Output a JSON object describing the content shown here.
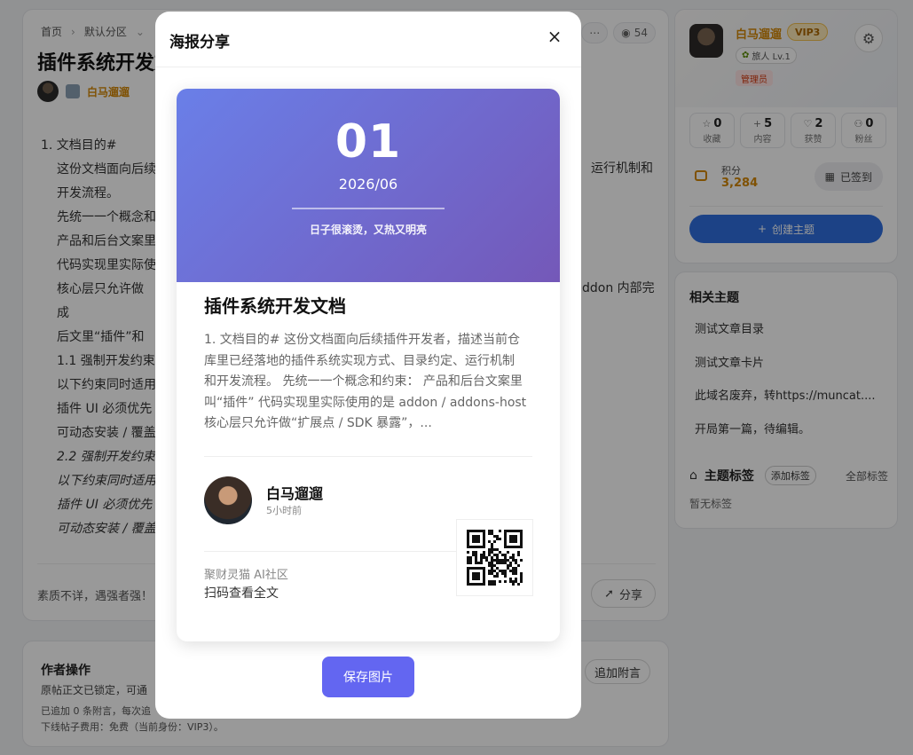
{
  "page": {
    "breadcrumb": [
      "首页",
      "默认分区"
    ],
    "title": "插件系统开发文",
    "views": "54",
    "author_name": "白马遛遛",
    "article_lines": [
      {
        "text": "1. 文档目的#",
        "style": "head"
      },
      {
        "text": "这份文档面向后续",
        "style": "ind"
      },
      {
        "text": "开发流程。",
        "style": "ind"
      },
      {
        "text": "先统一一个概念和",
        "style": "ind"
      },
      {
        "text": "产品和后台文案里",
        "style": "ind"
      },
      {
        "text": "代码实现里实际使",
        "style": "ind"
      },
      {
        "text": "核心层只允许做",
        "style": "ind"
      },
      {
        "text": "成",
        "style": "ind"
      },
      {
        "text": "后文里“插件”和",
        "style": "ind"
      },
      {
        "text": "1.1 强制开发约束",
        "style": "ind"
      },
      {
        "text": "以下约束同时适用",
        "style": "ind"
      },
      {
        "text": "插件 UI 必须优先",
        "style": "ind"
      },
      {
        "text": "可动态安装 / 覆盖",
        "style": "ind"
      },
      {
        "text": "2.2 强制开发约束",
        "style": "ind em"
      },
      {
        "text": "以下约束同时适用",
        "style": "ind em"
      },
      {
        "text": "插件 UI 必须优先",
        "style": "ind em"
      },
      {
        "text": "可动态安装 / 覆盖",
        "style": "ind em"
      }
    ],
    "right_fragment_1": "运行机制和",
    "right_fragment_2": "ddon 内部完",
    "motto": "素质不详，遇强者强！",
    "share_label": "分享"
  },
  "author_ops": {
    "title": "作者操作",
    "line1": "原帖正文已锁定，可通",
    "line2": "已追加 0 条附言，每次追",
    "line3": "下线帖子费用：免费（当前身份：VIP3）。",
    "append_label": "追加附言"
  },
  "profile": {
    "name": "白马遛遛",
    "vip": "VIP3",
    "level": "旅人 Lv.1",
    "role": "管理员",
    "stats": [
      {
        "icon": "☆",
        "value": "0",
        "label": "收藏"
      },
      {
        "icon": "+",
        "value": "5",
        "label": "内容"
      },
      {
        "icon": "♡",
        "value": "2",
        "label": "获赞"
      },
      {
        "icon": "⚇",
        "value": "0",
        "label": "粉丝"
      }
    ],
    "points_label": "积分",
    "points_value": "3,284",
    "checkin_label": "已签到",
    "create_label": "创建主题"
  },
  "related": {
    "title": "相关主题",
    "items": [
      "测试文章目录",
      "测试文章卡片",
      "此域名废弃，转https://muncat....",
      "开局第一篇，待编辑。"
    ],
    "tags_title": "主题标签",
    "add_tag": "添加标签",
    "all_tags": "全部标签",
    "no_tags": "暂无标签"
  },
  "modal": {
    "title": "海报分享",
    "close": "×",
    "save_label": "保存图片",
    "poster": {
      "day": "01",
      "date": "2026/06",
      "quote": "日子很滚烫，又热又明亮",
      "title": "插件系统开发文档",
      "excerpt_lines": [
        "1. 文档目的# 这份文档面向后续插件开发者，描述当前仓",
        "库里已经落地的插件系统实现方式、目录约定、运行机制",
        "和开发流程。 先统一一个概念和约束： 产品和后台文案里",
        "叫“插件” 代码实现里实际使用的是 addon / addons-host",
        "核心层只允许做“扩展点 / SDK 暴露”，..."
      ],
      "author": "白马遛遛",
      "time": "5小时前",
      "site": "聚财灵猫 AI社区",
      "scan_text": "扫码查看全文"
    }
  },
  "colors": {
    "accent": "#6366f1",
    "brand_blue": "#2f6fe0",
    "gold": "#d48806",
    "poster_gradient_start": "#6a7fe8",
    "poster_gradient_end": "#7458b8"
  },
  "icons": [
    "chevron-right-icon",
    "chevron-down-icon",
    "more-icon",
    "eye-icon",
    "gear-icon",
    "wallet-icon",
    "calendar-icon",
    "plus-icon",
    "tag-icon",
    "share-icon",
    "close-icon",
    "qr-code"
  ]
}
